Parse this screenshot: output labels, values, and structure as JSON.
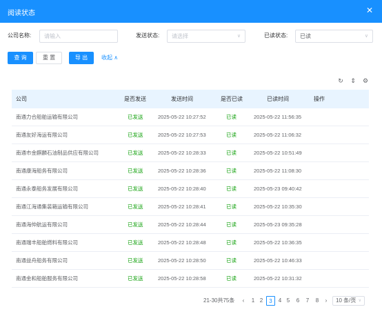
{
  "dialog": {
    "title": "阅读状态",
    "close_glyph": "✕"
  },
  "filters": {
    "company_label": "公司名称:",
    "company_placeholder": "请输入",
    "send_label": "发送状态:",
    "send_placeholder": "请选择",
    "read_label": "已读状态:",
    "read_value": "已读"
  },
  "actions": {
    "query": "查 询",
    "reset": "重 置",
    "export": "导 出",
    "collapse": "收起 ∧"
  },
  "columns": [
    "公司",
    "是否发送",
    "发送时间",
    "是否已读",
    "已读时间",
    "操作"
  ],
  "rows": [
    {
      "company": "南通力合船舶运输有限公司",
      "sent": "已发送",
      "sent_time": "2025-05-22 10:27:52",
      "read": "已读",
      "read_time": "2025-05-22 11:56:35"
    },
    {
      "company": "南通友好海运有限公司",
      "sent": "已发送",
      "sent_time": "2025-05-22 10:27:53",
      "read": "已读",
      "read_time": "2025-05-22 11:06:32"
    },
    {
      "company": "南通市金麒麟石油制品供应有限公司",
      "sent": "已发送",
      "sent_time": "2025-05-22 10:28:33",
      "read": "已读",
      "read_time": "2025-05-22 10:51:49"
    },
    {
      "company": "南通康海船务有限公司",
      "sent": "已发送",
      "sent_time": "2025-05-22 10:28:36",
      "read": "已读",
      "read_time": "2025-05-22 11:08:30"
    },
    {
      "company": "南通永泰船务发展有限公司",
      "sent": "已发送",
      "sent_time": "2025-05-22 10:28:40",
      "read": "已读",
      "read_time": "2025-05-23 09:40:42"
    },
    {
      "company": "南通江海通集装箱运输有限公司",
      "sent": "已发送",
      "sent_time": "2025-05-22 10:28:41",
      "read": "已读",
      "read_time": "2025-05-22 10:35:30"
    },
    {
      "company": "南通海仲航运有限公司",
      "sent": "已发送",
      "sent_time": "2025-05-22 10:28:44",
      "read": "已读",
      "read_time": "2025-05-23 09:35:28"
    },
    {
      "company": "南通瑞丰船舶燃料有限公司",
      "sent": "已发送",
      "sent_time": "2025-05-22 10:28:48",
      "read": "已读",
      "read_time": "2025-05-22 10:36:35"
    },
    {
      "company": "南通益舟船务有限公司",
      "sent": "已发送",
      "sent_time": "2025-05-22 10:28:50",
      "read": "已读",
      "read_time": "2025-05-22 10:46:33"
    },
    {
      "company": "南通金和船舶服务有限公司",
      "sent": "已发送",
      "sent_time": "2025-05-22 10:28:58",
      "read": "已读",
      "read_time": "2025-05-22 10:31:32"
    }
  ],
  "pagination": {
    "summary": "21-30共75条",
    "prev": "‹",
    "next": "›",
    "pages": [
      "1",
      "2",
      "3",
      "4",
      "5",
      "6",
      "7",
      "8"
    ],
    "current": "3",
    "page_size": "10 条/页"
  },
  "toolbar_icons": [
    "refresh-icon",
    "column-height-icon",
    "settings-icon"
  ],
  "colors": {
    "accent": "#1890ff",
    "status_green": "#13a10e",
    "header_row": "#e8f4ff"
  }
}
